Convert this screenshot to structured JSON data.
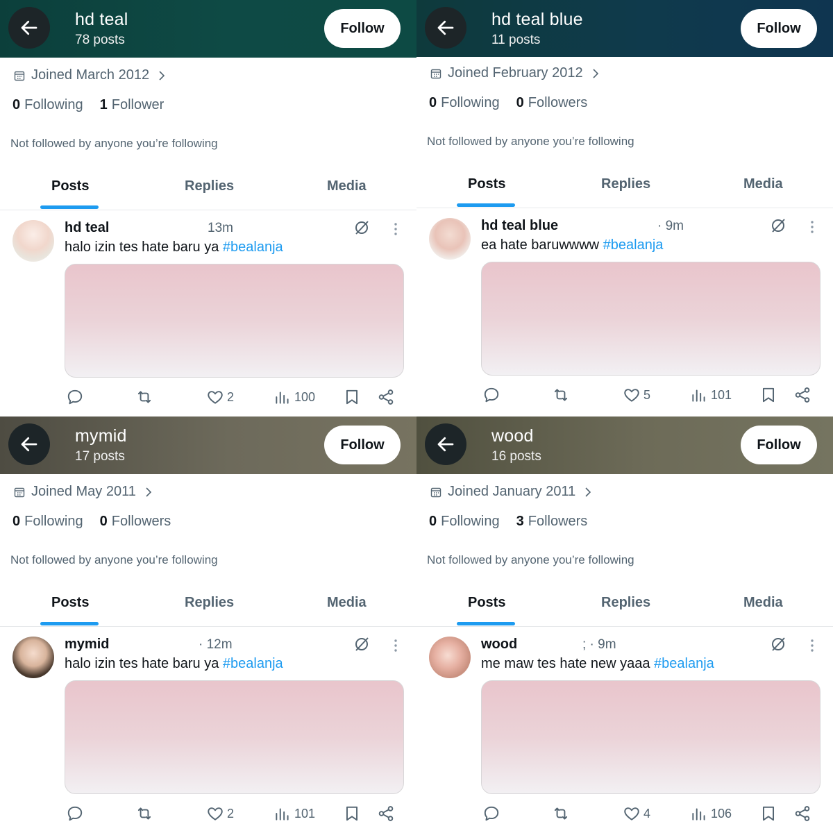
{
  "profiles": [
    {
      "name": "hd teal",
      "posts_count": "78 posts",
      "follow_label": "Follow",
      "joined": "Joined March 2012",
      "following_num": "0",
      "following_label": "Following",
      "followers_num": "1",
      "followers_label": "Follower",
      "not_followed": "Not followed by anyone you’re following",
      "tabs": [
        "Posts",
        "Replies",
        "Media"
      ],
      "post": {
        "author": "hd teal",
        "time": "13m",
        "text": "halo izin tes hate baru ya ",
        "hashtag": "#bealanja",
        "likes": "2",
        "views": "100"
      }
    },
    {
      "name": "hd teal blue",
      "posts_count": "11 posts",
      "follow_label": "Follow",
      "joined": "Joined February 2012",
      "following_num": "0",
      "following_label": "Following",
      "followers_num": "0",
      "followers_label": "Followers",
      "not_followed": "Not followed by anyone you’re following",
      "tabs": [
        "Posts",
        "Replies",
        "Media"
      ],
      "post": {
        "author": "hd teal blue",
        "time": "· 9m",
        "text": "ea hate baruwwww ",
        "hashtag": "#bealanja",
        "likes": "5",
        "views": "101"
      }
    },
    {
      "name": "mymid",
      "posts_count": "17 posts",
      "follow_label": "Follow",
      "joined": "Joined May 2011",
      "following_num": "0",
      "following_label": "Following",
      "followers_num": "0",
      "followers_label": "Followers",
      "not_followed": "Not followed by anyone you’re following",
      "tabs": [
        "Posts",
        "Replies",
        "Media"
      ],
      "post": {
        "author": "mymid",
        "time": "· 12m",
        "text": "halo izin tes hate baru ya ",
        "hashtag": "#bealanja",
        "likes": "2",
        "views": "101"
      }
    },
    {
      "name": "wood",
      "posts_count": "16 posts",
      "follow_label": "Follow",
      "joined": "Joined January 2011",
      "following_num": "0",
      "following_label": "Following",
      "followers_num": "3",
      "followers_label": "Followers",
      "not_followed": "Not followed by anyone you’re following",
      "tabs": [
        "Posts",
        "Replies",
        "Media"
      ],
      "post": {
        "author": "wood",
        "time": "; · 9m",
        "text": "me maw tes hate new yaaa ",
        "hashtag": "#bealanja",
        "likes": "4",
        "views": "106"
      }
    }
  ],
  "colors": {
    "accent": "#1d9bf0",
    "text_primary": "#0f1419",
    "text_secondary": "#536471",
    "header_teal": "#0e4a45",
    "header_teal_blue": "#0f3a4c",
    "header_olive": "#6d6a5b"
  },
  "icons": {
    "back": "arrow-left-icon",
    "calendar": "calendar-icon",
    "chevron": "chevron-right-icon",
    "grok": "grok-icon",
    "more": "more-vertical-icon",
    "reply": "reply-icon",
    "repost": "repost-icon",
    "like": "heart-icon",
    "views": "views-icon",
    "bookmark": "bookmark-icon",
    "share": "share-icon"
  }
}
